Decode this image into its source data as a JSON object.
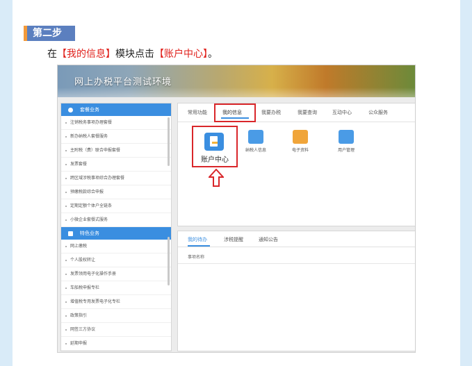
{
  "step": {
    "badge": "第二步"
  },
  "instruction": {
    "prefix": "在",
    "highlight1": "【我的信息】",
    "middle": "模块点击",
    "highlight2": "【账户中心】",
    "suffix": "。"
  },
  "banner": {
    "title": "网上办税平台测试环境"
  },
  "sidebar": {
    "section1": {
      "title": "套餐业务",
      "items": [
        "注销税务事项办理套餐",
        "新办纳税人套餐服务",
        "主附税（费）联合申报套餐",
        "发票套餐",
        "跨区域涉税事项综合办理套餐",
        "预缴税款综合申报",
        "定期定额个体户全链条",
        "小微企业套餐式服务"
      ]
    },
    "section2": {
      "title": "特色业务",
      "items": [
        "网上缴税",
        "个人股权转让",
        "发票领用电子化操作手册",
        "车船税申报专栏",
        "增值税专用发票电子化专栏",
        "政策指引",
        "网签三方协议",
        "延期申报"
      ]
    }
  },
  "tabs": [
    "常用功能",
    "我的信息",
    "我要办税",
    "我要查询",
    "互动中心",
    "公众服务"
  ],
  "tiles": {
    "account": "账户中心",
    "taxpayer": "纳税人信息",
    "documents": "电子资料",
    "users": "用户管理"
  },
  "bottom": {
    "tabs": [
      "我的待办",
      "涉税提醒",
      "通知公告"
    ],
    "column_header": "事项名称"
  },
  "colors": {
    "accent": "#3a8ee0",
    "highlight_red": "#e0201b",
    "step_badge": "#5b7fbf",
    "step_marker": "#f39a3a"
  },
  "icons": {
    "account": "document-person-icon",
    "taxpayer": "person-card-icon",
    "documents": "folder-stack-icon",
    "users": "users-icon",
    "pointer": "up-arrow-icon"
  }
}
